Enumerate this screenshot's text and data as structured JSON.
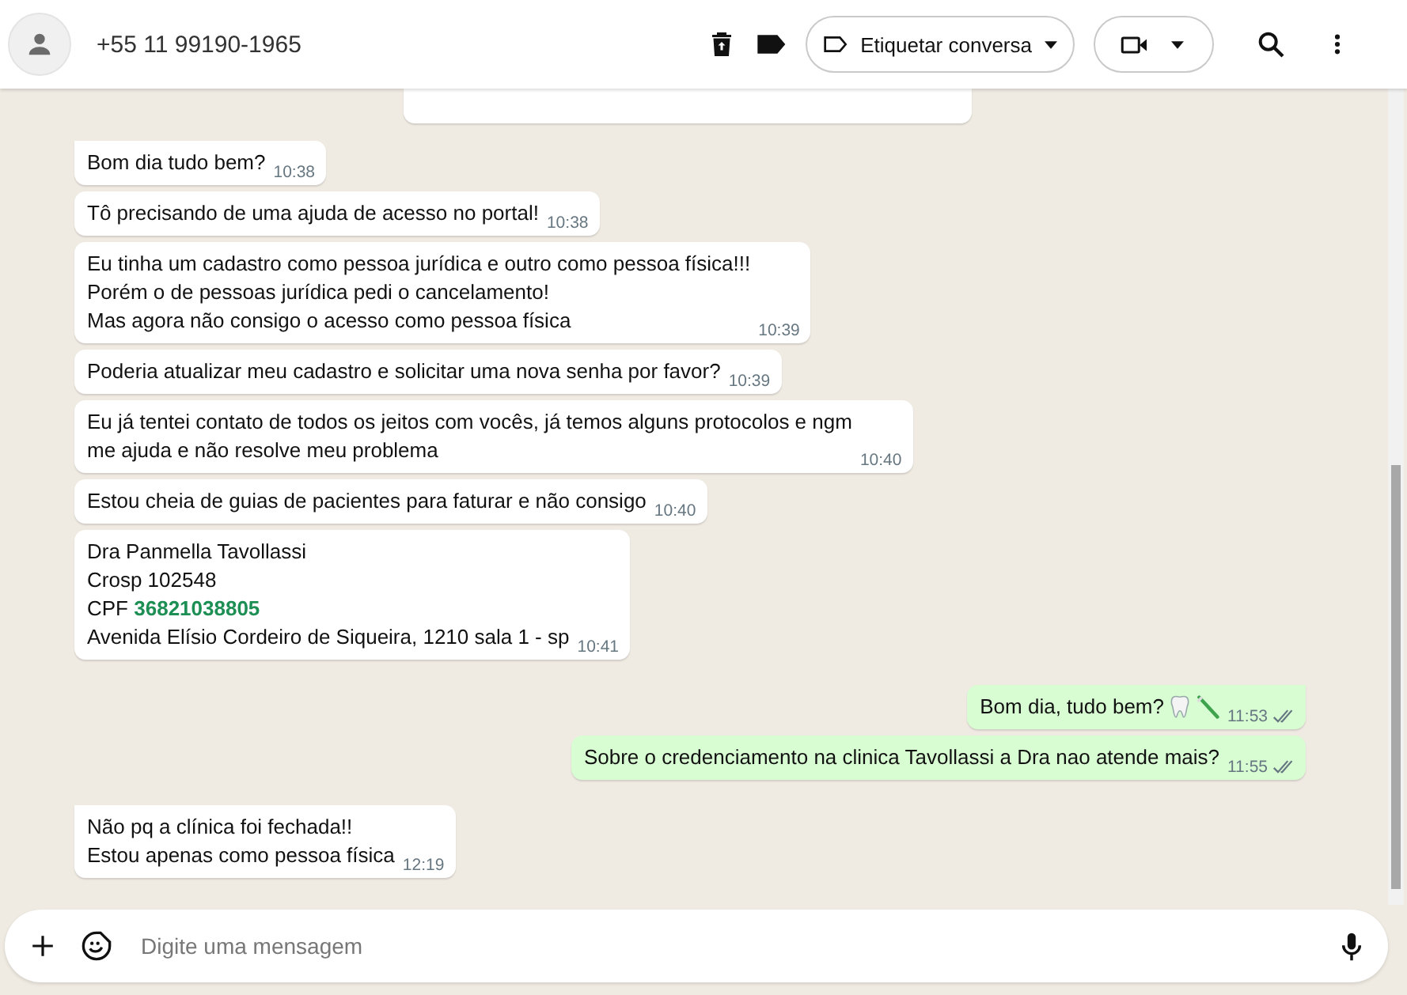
{
  "header": {
    "contact": "+55 11 99190-1965",
    "label_button": "Etiquetar conversa"
  },
  "partial_bubble": true,
  "messages": [
    {
      "kind": "in",
      "tail": true,
      "lines": [
        "Bom dia tudo bem?"
      ],
      "time": "10:38"
    },
    {
      "kind": "in",
      "tail": false,
      "lines": [
        "Tô precisando de uma ajuda de acesso no portal!"
      ],
      "time": "10:38"
    },
    {
      "kind": "in",
      "tail": false,
      "lines": [
        "Eu tinha um cadastro como pessoa jurídica e outro como pessoa física!!!",
        "Porém o de pessoas jurídica pedi o cancelamento!",
        "Mas agora não consigo o acesso como pessoa física"
      ],
      "time": "10:39"
    },
    {
      "kind": "in",
      "tail": false,
      "lines": [
        "Poderia atualizar meu cadastro e solicitar uma nova senha por favor?"
      ],
      "time": "10:39"
    },
    {
      "kind": "in",
      "tail": false,
      "lines": [
        "Eu já tentei contato de todos os jeitos com vocês, já temos alguns protocolos e ngm",
        "me ajuda e não resolve meu problema"
      ],
      "time": "10:40"
    },
    {
      "kind": "in",
      "tail": false,
      "lines": [
        "Estou cheia de guias de pacientes para faturar e não consigo"
      ],
      "time": "10:40"
    },
    {
      "kind": "in",
      "tail": false,
      "lines": [
        "Dra Panmella Tavollassi",
        "Crosp 102548",
        "CPF **36821038805**",
        "Avenida Elísio Cordeiro de Siqueira, 1210 sala 1 - sp"
      ],
      "time": "10:41"
    },
    {
      "kind": "out",
      "tail": true,
      "lines": [
        "Bom dia, tudo bem?"
      ],
      "emoji": [
        {
          "kind": "tooth"
        },
        {
          "kind": "toothbrush"
        }
      ],
      "time": "11:53",
      "read": false
    },
    {
      "kind": "out",
      "tail": false,
      "lines": [
        "Sobre o credenciamento na clinica Tavollassi a Dra nao atende mais?"
      ],
      "time": "11:55",
      "read": false
    },
    {
      "kind": "in",
      "tail": true,
      "lines": [
        "Não pq a clínica foi fechada!!",
        "Estou apenas como pessoa física"
      ],
      "time": "12:19"
    }
  ],
  "composer": {
    "placeholder": "Digite uma mensagem"
  }
}
